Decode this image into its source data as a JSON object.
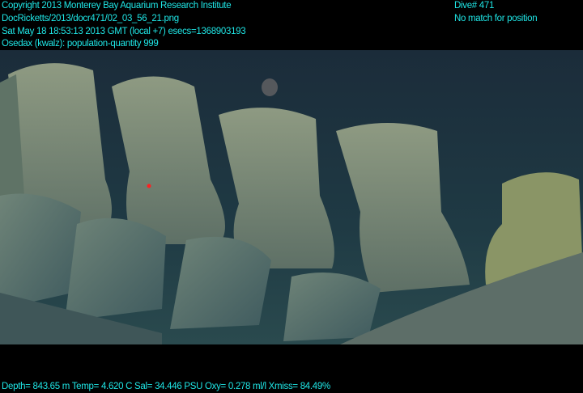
{
  "header": {
    "copyright": "Copyright 2013 Monterey Bay Aquarium Research Institute",
    "file_path": "DocRicketts/2013/docr471/02_03_56_21.png",
    "timestamp": "Sat May 18 18:53:13 2013 GMT (local +7)  esecs=1368903193",
    "annotation": "Osedax (kwalz): population-quantity 999",
    "dive": "Dive# 471",
    "position_status": "No match for position"
  },
  "footer": {
    "telemetry": "Depth= 843.65 m  Temp= 4.620 C  Sal= 34.446 PSU  Oxy= 0.278 ml/l  Xmiss= 84.49%"
  },
  "colors": {
    "overlay_text": "#1fe6e6",
    "water": "#1c3540",
    "bone": "#7f8e72"
  }
}
